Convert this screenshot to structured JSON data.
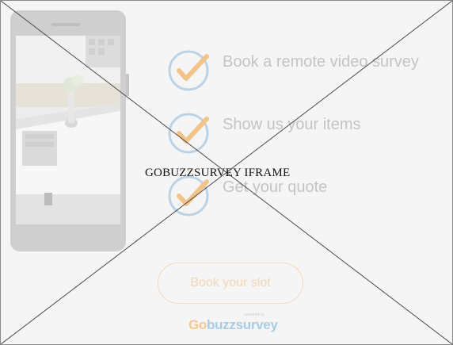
{
  "placeholder": {
    "label": "GOBUZZSURVEY IFRAME"
  },
  "steps": [
    {
      "label": "Book a remote video survey",
      "icon": "check-icon"
    },
    {
      "label": "Show us your items",
      "icon": "check-icon"
    },
    {
      "label": "Get your quote",
      "icon": "check-icon"
    }
  ],
  "cta": {
    "label": "Book your slot"
  },
  "brand": {
    "powered_by": "powered by",
    "logo_go": "Go",
    "logo_buzz": "buzz",
    "logo_survey": "survey"
  },
  "colors": {
    "check_circle": "#bcd3e6",
    "check_mark": "#f3c48a",
    "button_border": "#f3d9bd",
    "brand_go": "#f4c98f",
    "brand_rest": "#a9cbe3"
  }
}
